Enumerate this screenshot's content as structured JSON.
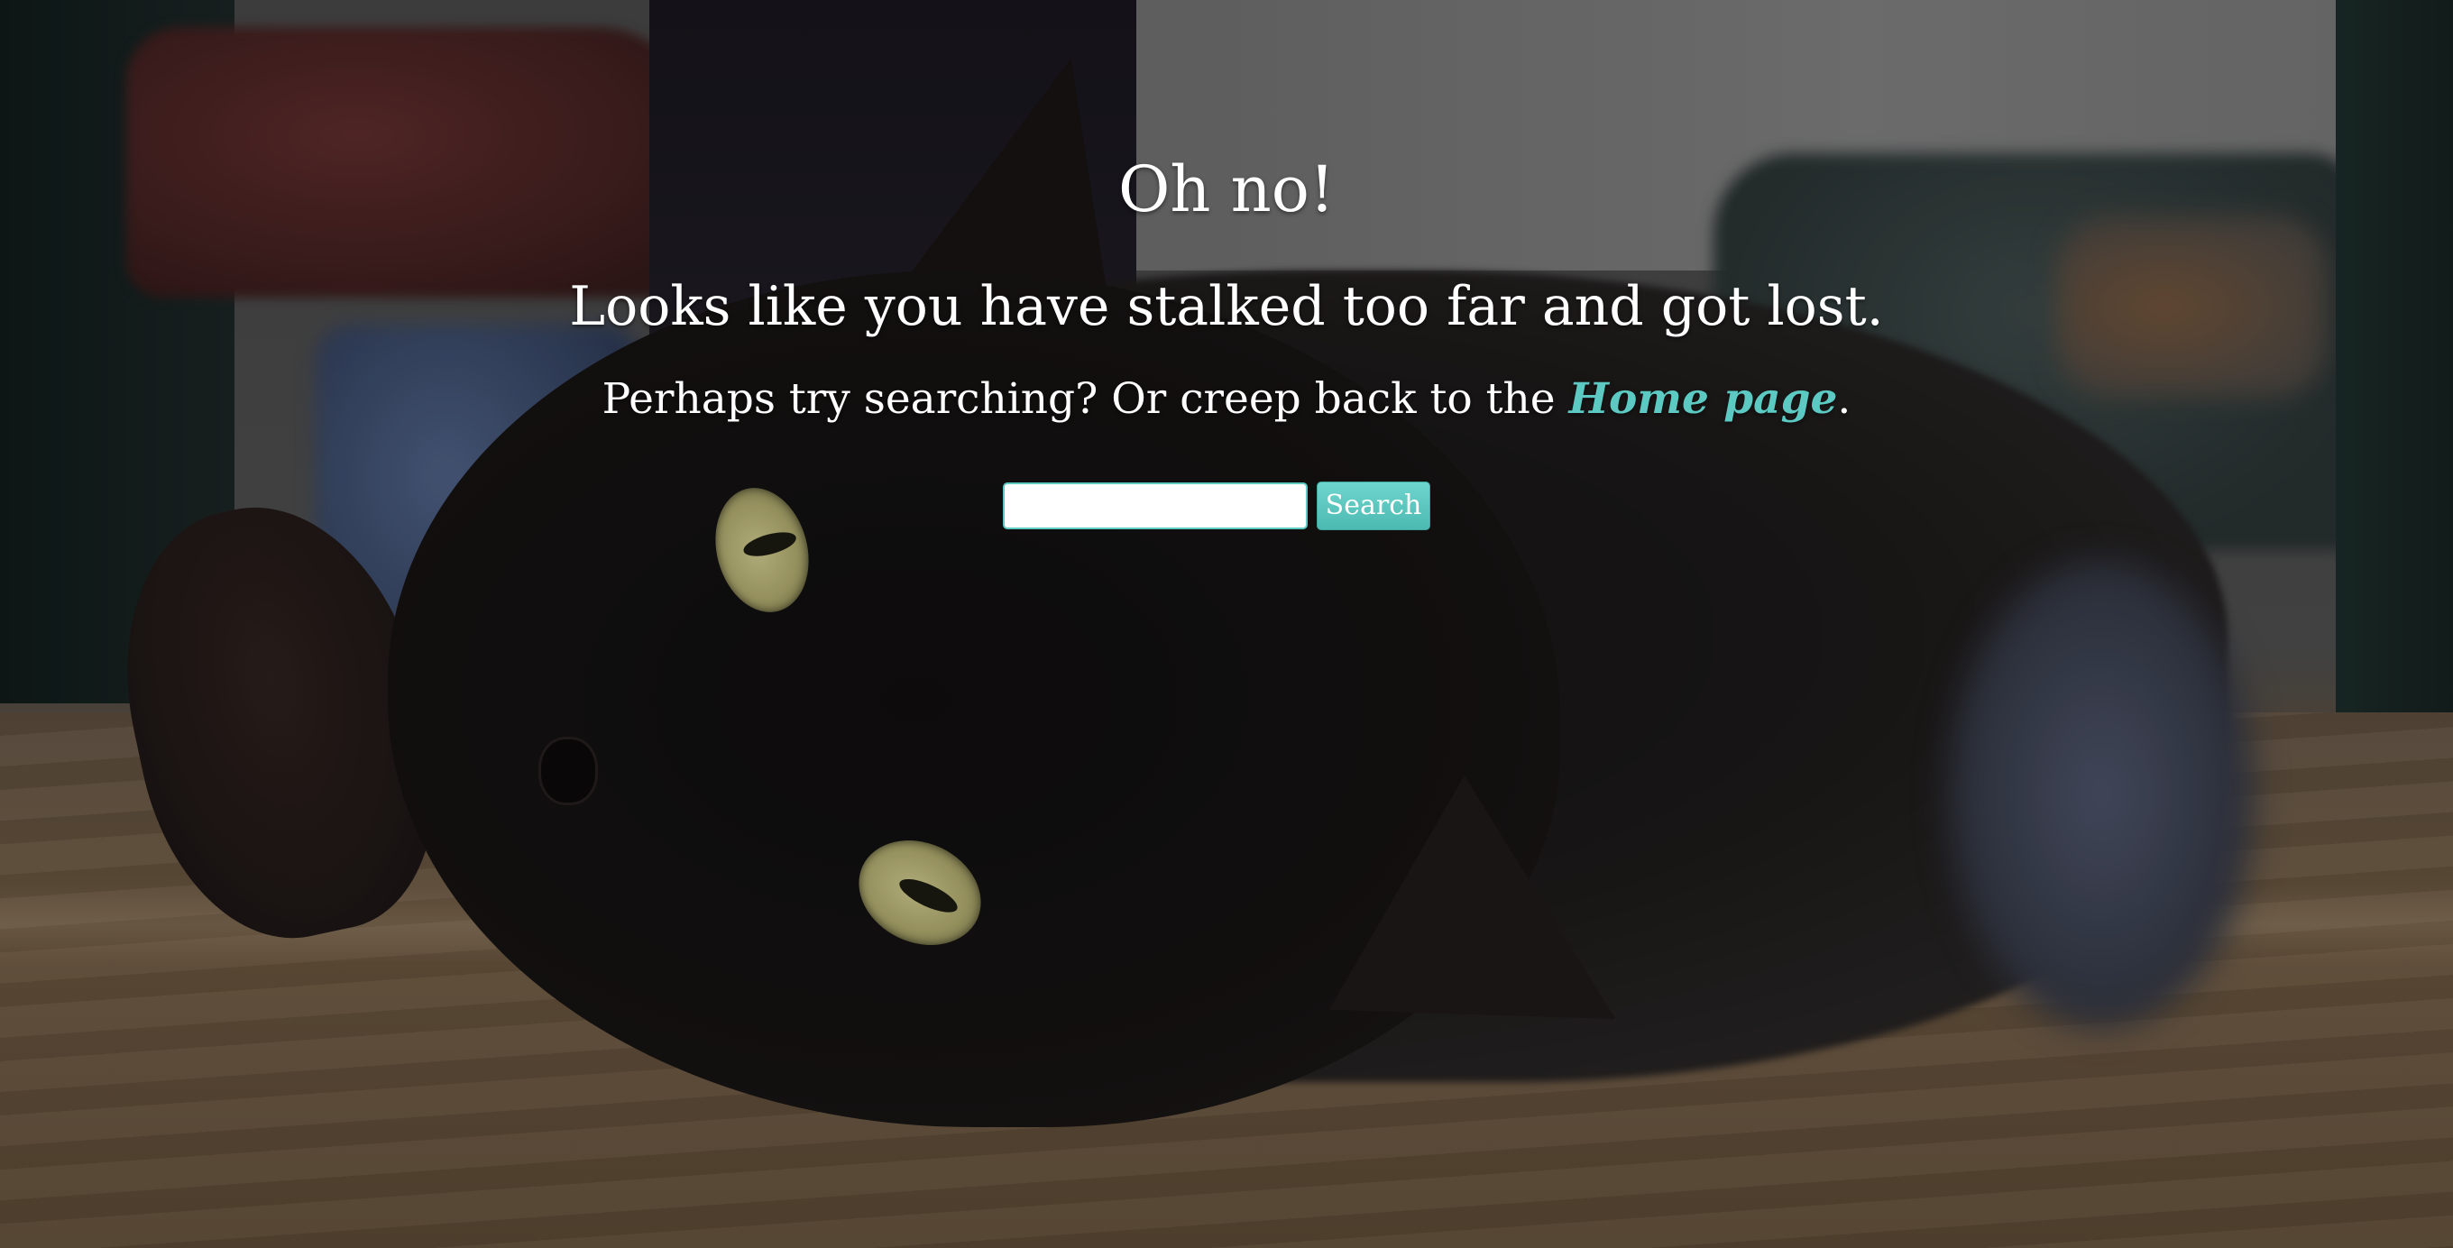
{
  "heading": "Oh no!",
  "subheading": "Looks like you have stalked too far and got lost.",
  "hint": {
    "prefix": "Perhaps try searching? Or creep back to the ",
    "link_label": "Home page",
    "suffix": "."
  },
  "search": {
    "value": "",
    "placeholder": "",
    "button_label": "Search"
  },
  "colors": {
    "accent": "#5ccac2",
    "text": "#ffffff"
  }
}
